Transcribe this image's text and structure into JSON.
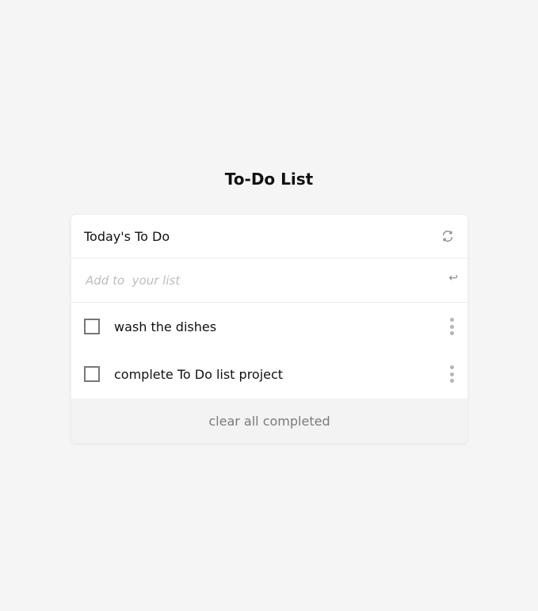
{
  "app": {
    "title": "To-Do List"
  },
  "card": {
    "list_title": "Today's To Do",
    "refresh_icon": "refresh-icon"
  },
  "add": {
    "placeholder": "Add to  your list",
    "value": "",
    "enter_icon": "enter-icon",
    "enter_glyph": "↩"
  },
  "todos": [
    {
      "text": "wash the dishes",
      "checked": false
    },
    {
      "text": "complete To Do list project",
      "checked": false
    }
  ],
  "footer": {
    "clear_label": "clear all completed"
  },
  "colors": {
    "background": "#f5f5f5",
    "card": "#ffffff",
    "footer": "#f3f3f3",
    "muted_text": "#7a7a7a"
  }
}
